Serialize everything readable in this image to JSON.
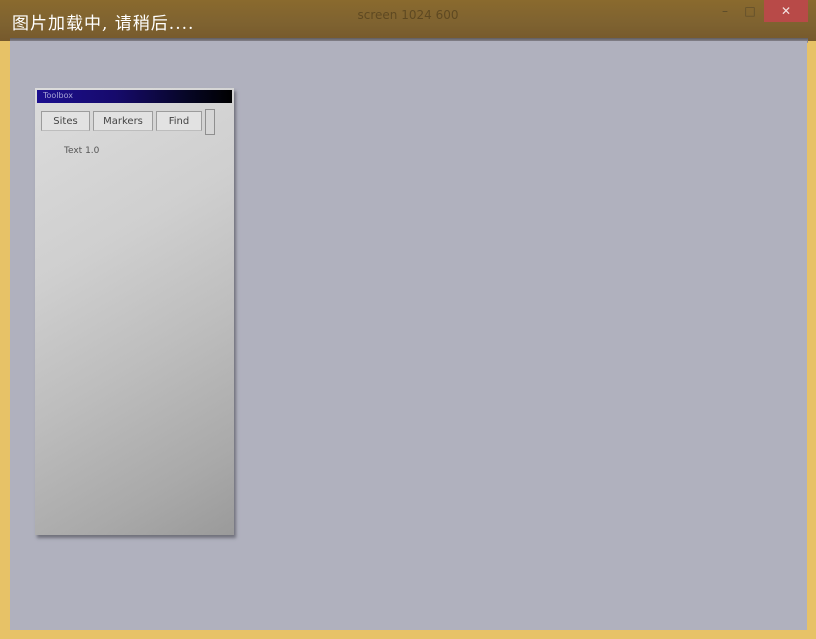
{
  "window": {
    "title": "screen 1024 600",
    "loading_text": "图片加载中, 请稍后....",
    "minimize": "–",
    "maximize": "□",
    "close": "✕"
  },
  "panel": {
    "title": "Toolbox",
    "tabs": [
      "Sites",
      "Markers",
      "Find"
    ],
    "label": "Text 1.0"
  },
  "colors": {
    "frame": "#e7c267",
    "titlebar": "#7e6230",
    "client_background": "#b0b1be",
    "panel_titlebar": "#1c0f8f",
    "close_button": "#b84a48"
  }
}
